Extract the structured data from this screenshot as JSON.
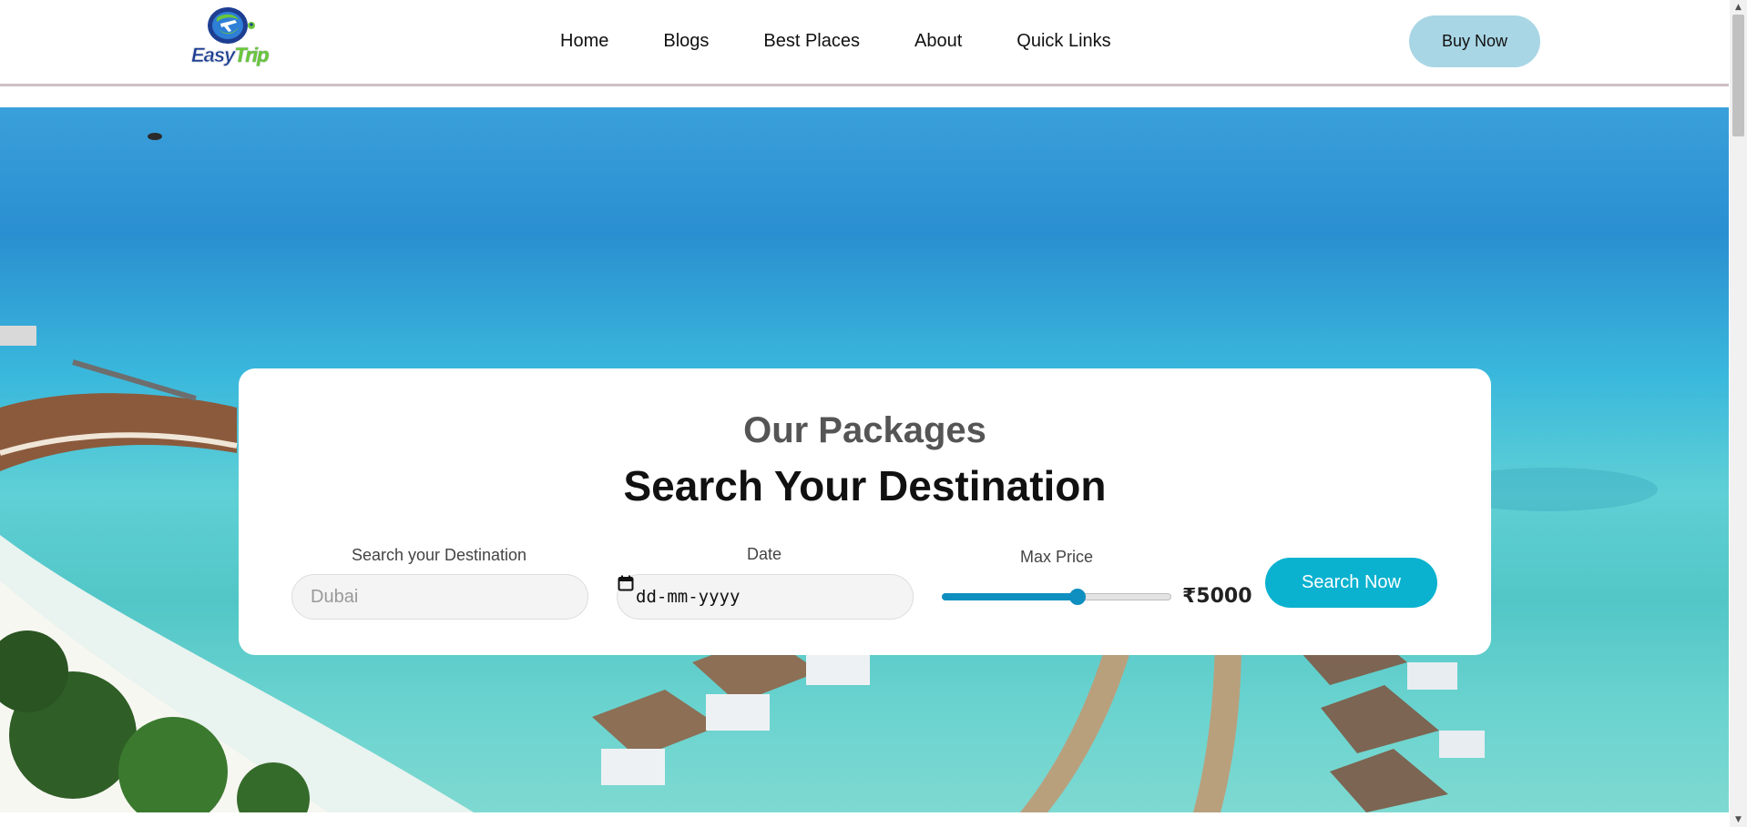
{
  "header": {
    "logo": {
      "part1": "Easy",
      "part2": "Trip"
    },
    "nav": [
      {
        "label": "Home",
        "name": "nav-home"
      },
      {
        "label": "Blogs",
        "name": "nav-blogs"
      },
      {
        "label": "Best Places",
        "name": "nav-best-places"
      },
      {
        "label": "About",
        "name": "nav-about"
      },
      {
        "label": "Quick Links",
        "name": "nav-quick-links"
      }
    ],
    "buy_label": "Buy Now"
  },
  "packages": {
    "subtitle": "Our Packages",
    "title": "Search Your Destination",
    "destination": {
      "label": "Search your Destination",
      "placeholder": "Dubai"
    },
    "date": {
      "label": "Date",
      "placeholder": "dd-mm-yyyy"
    },
    "price": {
      "label": "Max Price",
      "display": "₹5000",
      "fraction": 0.59
    },
    "search_label": "Search Now"
  },
  "colors": {
    "accent": "#0bb2cf",
    "buy_button": "#a9d6e5",
    "slider": "#0e8fbf"
  },
  "icons": [
    "calendar-icon",
    "logo-pin-icon",
    "scroll-up-arrow-icon",
    "scroll-down-arrow-icon"
  ]
}
